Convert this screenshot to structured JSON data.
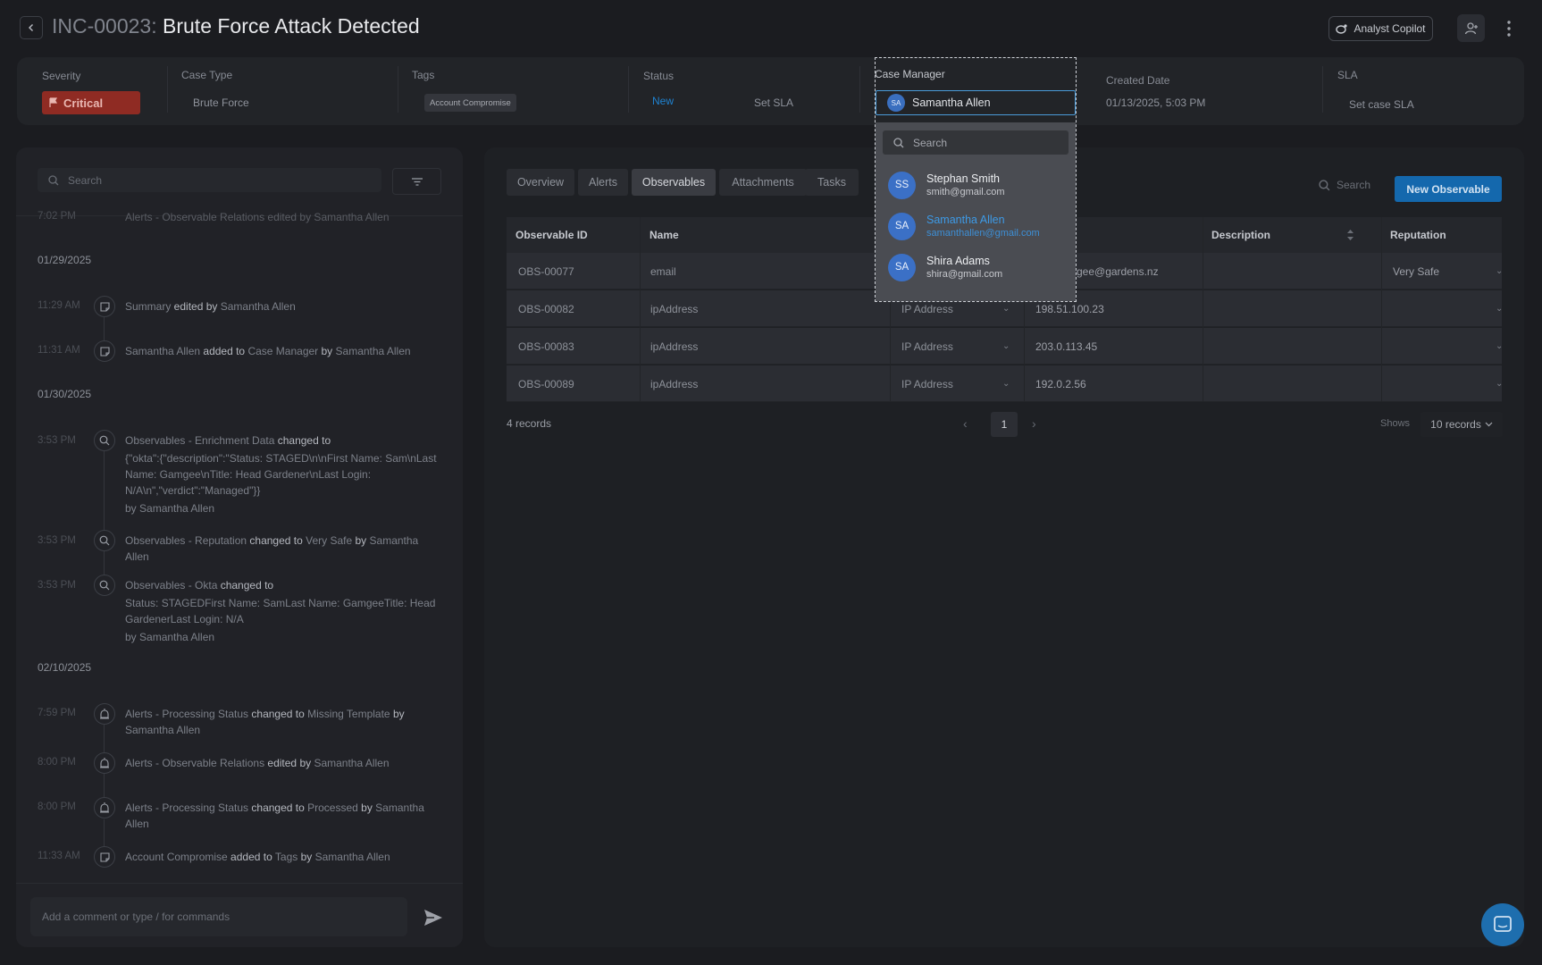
{
  "header": {
    "id": "INC-00023:",
    "title": "Brute Force Attack Detected",
    "copilot_label": "Analyst Copilot"
  },
  "info": {
    "severity_label": "Severity",
    "severity_value": "Critical",
    "case_type_label": "Case Type",
    "case_type_value": "Brute Force",
    "tags_label": "Tags",
    "tag": "Account Compromise",
    "status_label": "Status",
    "status_value": "New",
    "set_sla": "Set SLA",
    "case_manager_label": "Case Manager",
    "created_label": "Created Date",
    "created_value": "01/13/2025, 5:03 PM",
    "sla_label": "SLA",
    "sla_value": "Set case SLA"
  },
  "case_manager": {
    "selected_initials": "SA",
    "selected_name": "Samantha Allen",
    "search_placeholder": "Search",
    "options": [
      {
        "initials": "SS",
        "name": "Stephan Smith",
        "email": "smith@gmail.com"
      },
      {
        "initials": "SA",
        "name": "Samantha Allen",
        "email": "samanthallen@gmail.com"
      },
      {
        "initials": "SA",
        "name": "Shira Adams",
        "email": "shira@gmail.com"
      }
    ]
  },
  "timeline": {
    "search_placeholder": "Search",
    "clipped_entry": "Alerts - Observable Relations edited by Samantha Allen",
    "clipped_time": "7:02 PM",
    "dates": [
      "01/29/2025",
      "01/30/2025",
      "02/10/2025"
    ],
    "entries": [
      {
        "time": "11:29 AM",
        "a": "Summary",
        "verb": " edited by ",
        "b": "Samantha Allen"
      },
      {
        "time": "11:31 AM",
        "a": "Samantha Allen",
        "verb": " added to ",
        "b": "Case Manager",
        "verb2": " by ",
        "c": "Samantha Allen"
      },
      {
        "time": "3:53 PM",
        "a": "Observables - Enrichment Data",
        "verb": " changed to",
        "detail": "{\"okta\":{\"description\":\"Status: STAGED\\n\\nFirst Name: Sam\\nLast Name: Gamgee\\nTitle: Head Gardener\\nLast Login: N/A\\n\",\"verdict\":\"Managed\"}}",
        "by": "by ",
        "who": "Samantha Allen"
      },
      {
        "time": "3:53 PM",
        "a": "Observables - Reputation",
        "verb": " changed to ",
        "b": "Very Safe",
        "verb2": " by ",
        "c": "Samantha Allen"
      },
      {
        "time": "3:53 PM",
        "a": "Observables - Okta",
        "verb": " changed to",
        "detail": "Status: STAGEDFirst Name: SamLast Name: GamgeeTitle: Head GardenerLast Login: N/A",
        "by": "by ",
        "who": "Samantha Allen"
      },
      {
        "time": "7:59 PM",
        "a": "Alerts - Processing Status",
        "verb": " changed to ",
        "b": "Missing Template",
        "verb2": " by ",
        "c": "Samantha Allen"
      },
      {
        "time": "8:00 PM",
        "a": "Alerts - Observable Relations",
        "verb": " edited by ",
        "b": "Samantha Allen"
      },
      {
        "time": "8:00 PM",
        "a": "Alerts - Processing Status",
        "verb": " changed to ",
        "b": "Processed",
        "verb2": " by ",
        "c": "Samantha Allen"
      },
      {
        "time": "11:33 AM",
        "a": "Account Compromise",
        "verb": " added to ",
        "b": "Tags",
        "verb2": " by ",
        "c": "Samantha Allen"
      }
    ],
    "comment_placeholder": "Add a comment or type / for commands"
  },
  "tabs": [
    "Overview",
    "Alerts",
    "Observables",
    "Attachments",
    "Tasks"
  ],
  "table": {
    "search_label": "Search",
    "new_button": "New Observable",
    "headers": [
      "Observable ID",
      "Name",
      "Description",
      "Reputation"
    ],
    "rows": [
      {
        "id": "OBS-00077",
        "name": "email",
        "type": "",
        "value": "gee@gardens.nz",
        "description": "",
        "reputation": "Very Safe"
      },
      {
        "id": "OBS-00082",
        "name": "ipAddress",
        "type": "IP Address",
        "value": "198.51.100.23",
        "description": "",
        "reputation": ""
      },
      {
        "id": "OBS-00083",
        "name": "ipAddress",
        "type": "IP Address",
        "value": "203.0.113.45",
        "description": "",
        "reputation": ""
      },
      {
        "id": "OBS-00089",
        "name": "ipAddress",
        "type": "IP Address",
        "value": "192.0.2.56",
        "description": "",
        "reputation": ""
      }
    ],
    "records_count": "4 records",
    "page": "1",
    "shows_label": "Shows",
    "per_page": "10 records"
  }
}
